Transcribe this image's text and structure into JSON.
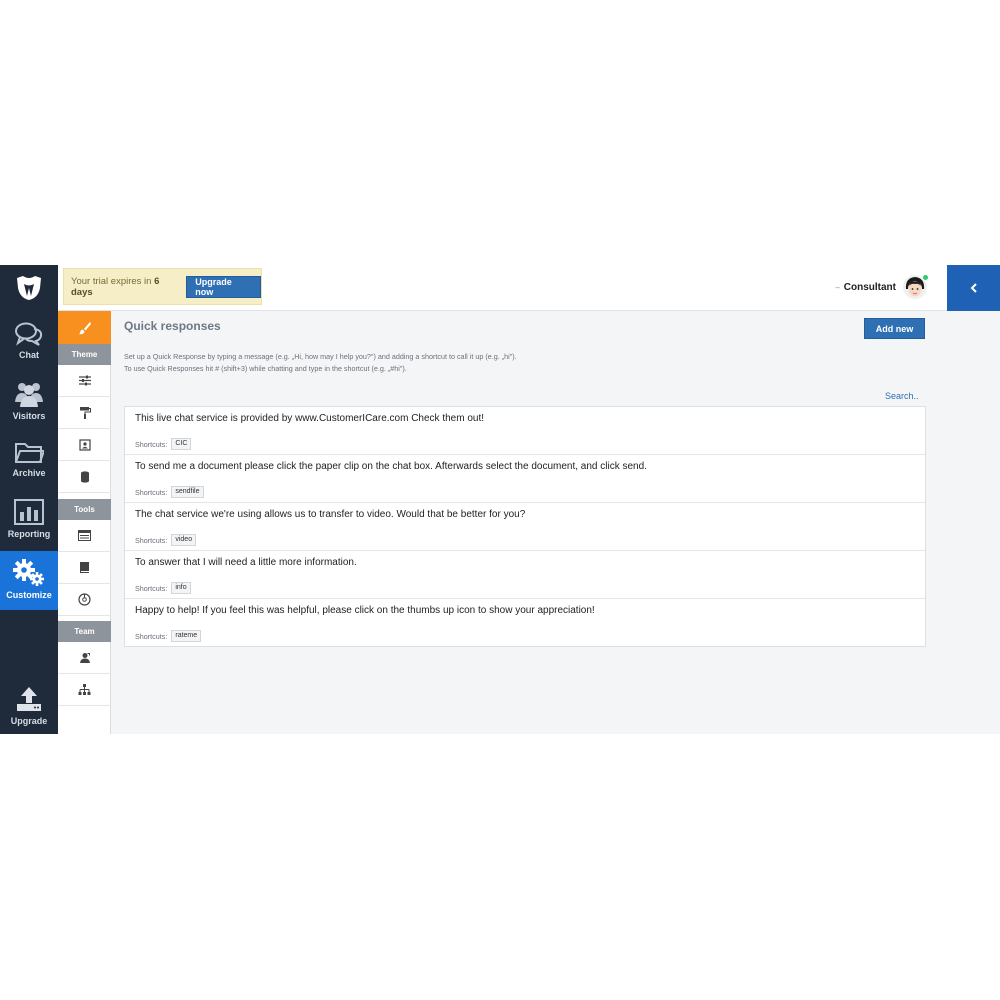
{
  "colors": {
    "nav_bg": "#1f2a3a",
    "nav_active": "#1a73d9",
    "accent_orange": "#f7901e",
    "primary_button": "#2f6fb3",
    "collapse_bg": "#1f61b5",
    "trial_bg": "#f5eec6",
    "online_status": "#2ecc71"
  },
  "nav": {
    "logo_icon": "logo-icon",
    "items": [
      {
        "label": "Chat",
        "icon": "chat-bubbles-icon"
      },
      {
        "label": "Visitors",
        "icon": "visitors-icon"
      },
      {
        "label": "Archive",
        "icon": "folder-icon"
      },
      {
        "label": "Reporting",
        "icon": "bar-chart-icon"
      },
      {
        "label": "Customize",
        "icon": "gears-icon",
        "active": true
      },
      {
        "label": "Upgrade",
        "icon": "upload-icon"
      }
    ]
  },
  "submenu": {
    "top_icon": "brush-icon",
    "sections": [
      {
        "heading": "Theme",
        "items": [
          "sliders-icon",
          "paint-roller-icon",
          "contact-card-icon",
          "database-icon"
        ]
      },
      {
        "heading": "Tools",
        "items": [
          "window-icon",
          "book-icon",
          "compass-icon"
        ]
      },
      {
        "heading": "Team",
        "items": [
          "user-icon",
          "org-chart-icon"
        ]
      }
    ]
  },
  "topbar": {
    "trial_prefix": "Your trial expires in ",
    "trial_days": "6 days",
    "upgrade_label": "Upgrade now",
    "user_name": "Consultant",
    "collapse_icon": "chevron-left-icon"
  },
  "main": {
    "title": "Quick responses",
    "add_new_label": "Add new",
    "help_line_1": "Set up a Quick Response by typing a message (e.g. „Hi, how may I help you?\") and adding a shortcut to call it up (e.g. „hi\").",
    "help_line_2": "To use Quick Responses hit # (shift+3) while chatting and type in the shortcut (e.g. „#hi\").",
    "search_label": "Search..",
    "shortcuts_label": "Shortcuts:",
    "responses": [
      {
        "message": "This live chat service is provided by www.CustomerICare.com Check them out!",
        "shortcut": "CIC"
      },
      {
        "message": "To send me a document please click the paper clip on the chat box. Afterwards select the document, and click send.",
        "shortcut": "sendfile"
      },
      {
        "message": "The chat service we're using allows us to transfer to video. Would that be better for you?",
        "shortcut": "video"
      },
      {
        "message": "To answer that I will need a little more information.",
        "shortcut": "info"
      },
      {
        "message": "Happy to help! If you feel this was helpful, please click on the thumbs up icon to show your appreciation!",
        "shortcut": "rateme"
      }
    ]
  }
}
